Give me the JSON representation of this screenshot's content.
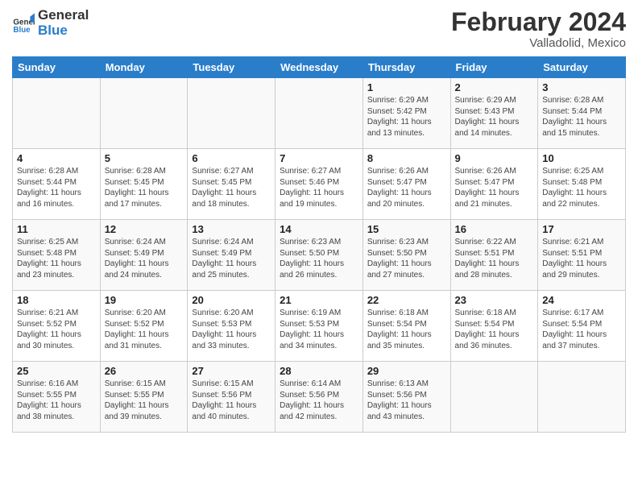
{
  "header": {
    "logo_general": "General",
    "logo_blue": "Blue",
    "month_year": "February 2024",
    "location": "Valladolid, Mexico"
  },
  "days_of_week": [
    "Sunday",
    "Monday",
    "Tuesday",
    "Wednesday",
    "Thursday",
    "Friday",
    "Saturday"
  ],
  "weeks": [
    [
      {
        "day": "",
        "info": ""
      },
      {
        "day": "",
        "info": ""
      },
      {
        "day": "",
        "info": ""
      },
      {
        "day": "",
        "info": ""
      },
      {
        "day": "1",
        "info": "Sunrise: 6:29 AM\nSunset: 5:42 PM\nDaylight: 11 hours\nand 13 minutes."
      },
      {
        "day": "2",
        "info": "Sunrise: 6:29 AM\nSunset: 5:43 PM\nDaylight: 11 hours\nand 14 minutes."
      },
      {
        "day": "3",
        "info": "Sunrise: 6:28 AM\nSunset: 5:44 PM\nDaylight: 11 hours\nand 15 minutes."
      }
    ],
    [
      {
        "day": "4",
        "info": "Sunrise: 6:28 AM\nSunset: 5:44 PM\nDaylight: 11 hours\nand 16 minutes."
      },
      {
        "day": "5",
        "info": "Sunrise: 6:28 AM\nSunset: 5:45 PM\nDaylight: 11 hours\nand 17 minutes."
      },
      {
        "day": "6",
        "info": "Sunrise: 6:27 AM\nSunset: 5:45 PM\nDaylight: 11 hours\nand 18 minutes."
      },
      {
        "day": "7",
        "info": "Sunrise: 6:27 AM\nSunset: 5:46 PM\nDaylight: 11 hours\nand 19 minutes."
      },
      {
        "day": "8",
        "info": "Sunrise: 6:26 AM\nSunset: 5:47 PM\nDaylight: 11 hours\nand 20 minutes."
      },
      {
        "day": "9",
        "info": "Sunrise: 6:26 AM\nSunset: 5:47 PM\nDaylight: 11 hours\nand 21 minutes."
      },
      {
        "day": "10",
        "info": "Sunrise: 6:25 AM\nSunset: 5:48 PM\nDaylight: 11 hours\nand 22 minutes."
      }
    ],
    [
      {
        "day": "11",
        "info": "Sunrise: 6:25 AM\nSunset: 5:48 PM\nDaylight: 11 hours\nand 23 minutes."
      },
      {
        "day": "12",
        "info": "Sunrise: 6:24 AM\nSunset: 5:49 PM\nDaylight: 11 hours\nand 24 minutes."
      },
      {
        "day": "13",
        "info": "Sunrise: 6:24 AM\nSunset: 5:49 PM\nDaylight: 11 hours\nand 25 minutes."
      },
      {
        "day": "14",
        "info": "Sunrise: 6:23 AM\nSunset: 5:50 PM\nDaylight: 11 hours\nand 26 minutes."
      },
      {
        "day": "15",
        "info": "Sunrise: 6:23 AM\nSunset: 5:50 PM\nDaylight: 11 hours\nand 27 minutes."
      },
      {
        "day": "16",
        "info": "Sunrise: 6:22 AM\nSunset: 5:51 PM\nDaylight: 11 hours\nand 28 minutes."
      },
      {
        "day": "17",
        "info": "Sunrise: 6:21 AM\nSunset: 5:51 PM\nDaylight: 11 hours\nand 29 minutes."
      }
    ],
    [
      {
        "day": "18",
        "info": "Sunrise: 6:21 AM\nSunset: 5:52 PM\nDaylight: 11 hours\nand 30 minutes."
      },
      {
        "day": "19",
        "info": "Sunrise: 6:20 AM\nSunset: 5:52 PM\nDaylight: 11 hours\nand 31 minutes."
      },
      {
        "day": "20",
        "info": "Sunrise: 6:20 AM\nSunset: 5:53 PM\nDaylight: 11 hours\nand 33 minutes."
      },
      {
        "day": "21",
        "info": "Sunrise: 6:19 AM\nSunset: 5:53 PM\nDaylight: 11 hours\nand 34 minutes."
      },
      {
        "day": "22",
        "info": "Sunrise: 6:18 AM\nSunset: 5:54 PM\nDaylight: 11 hours\nand 35 minutes."
      },
      {
        "day": "23",
        "info": "Sunrise: 6:18 AM\nSunset: 5:54 PM\nDaylight: 11 hours\nand 36 minutes."
      },
      {
        "day": "24",
        "info": "Sunrise: 6:17 AM\nSunset: 5:54 PM\nDaylight: 11 hours\nand 37 minutes."
      }
    ],
    [
      {
        "day": "25",
        "info": "Sunrise: 6:16 AM\nSunset: 5:55 PM\nDaylight: 11 hours\nand 38 minutes."
      },
      {
        "day": "26",
        "info": "Sunrise: 6:15 AM\nSunset: 5:55 PM\nDaylight: 11 hours\nand 39 minutes."
      },
      {
        "day": "27",
        "info": "Sunrise: 6:15 AM\nSunset: 5:56 PM\nDaylight: 11 hours\nand 40 minutes."
      },
      {
        "day": "28",
        "info": "Sunrise: 6:14 AM\nSunset: 5:56 PM\nDaylight: 11 hours\nand 42 minutes."
      },
      {
        "day": "29",
        "info": "Sunrise: 6:13 AM\nSunset: 5:56 PM\nDaylight: 11 hours\nand 43 minutes."
      },
      {
        "day": "",
        "info": ""
      },
      {
        "day": "",
        "info": ""
      }
    ]
  ]
}
